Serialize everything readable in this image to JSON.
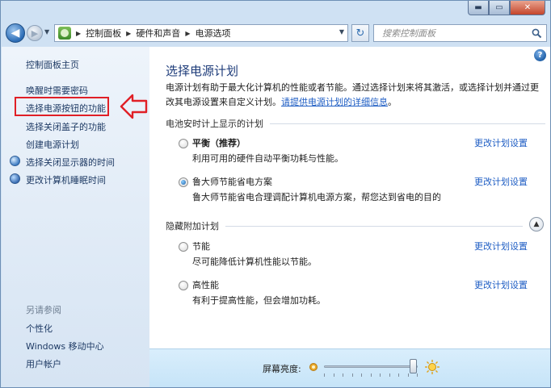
{
  "window": {
    "caption": {
      "minimize": "▬",
      "maximize": "▭",
      "close": "✕"
    }
  },
  "nav": {
    "back_icon": "back-arrow-icon",
    "forward_icon": "forward-arrow-icon",
    "breadcrumbs": [
      "控制面板",
      "硬件和声音",
      "电源选项"
    ],
    "search_placeholder": "搜索控制面板"
  },
  "sidebar": {
    "home": "控制面板主页",
    "items": [
      {
        "label": "唤醒时需要密码",
        "icon": ""
      },
      {
        "label": "选择电源按钮的功能",
        "icon": ""
      },
      {
        "label": "选择关闭盖子的功能",
        "icon": ""
      },
      {
        "label": "创建电源计划",
        "icon": ""
      },
      {
        "label": "选择关闭显示器的时间",
        "icon": "monitor-icon"
      },
      {
        "label": "更改计算机睡眠时间",
        "icon": "globe-icon"
      }
    ],
    "see_also_title": "另请参阅",
    "see_also": [
      "个性化",
      "Windows 移动中心",
      "用户帐户"
    ],
    "annotation_color": "#e01f26"
  },
  "main": {
    "title": "选择电源计划",
    "description": "电源计划有助于最大化计算机的性能或者节能。通过选择计划来将其激活，或选择计划并通过更改其电源设置来自定义计划。",
    "description_link": "请提供电源计划的详细信息",
    "battery_section": {
      "header": "电池安时计上显示的计划",
      "plans": [
        {
          "name": "平衡（推荐）",
          "desc": "利用可用的硬件自动平衡功耗与性能。",
          "link": "更改计划设置",
          "selected": false,
          "bold": true
        },
        {
          "name": "鲁大师节能省电方案",
          "desc": "鲁大师节能省电合理调配计算机电源方案，帮您达到省电的目的",
          "link": "更改计划设置",
          "selected": true,
          "bold": false
        }
      ]
    },
    "hidden_section": {
      "header": "隐藏附加计划",
      "plans": [
        {
          "name": "节能",
          "desc": "尽可能降低计算机性能以节能。",
          "link": "更改计划设置",
          "selected": false,
          "bold": false
        },
        {
          "name": "高性能",
          "desc": "有利于提高性能，但会增加功耗。",
          "link": "更改计划设置",
          "selected": false,
          "bold": false
        }
      ]
    }
  },
  "bottom": {
    "brightness_label": "屏幕亮度:",
    "brightness_level": 0.95
  }
}
